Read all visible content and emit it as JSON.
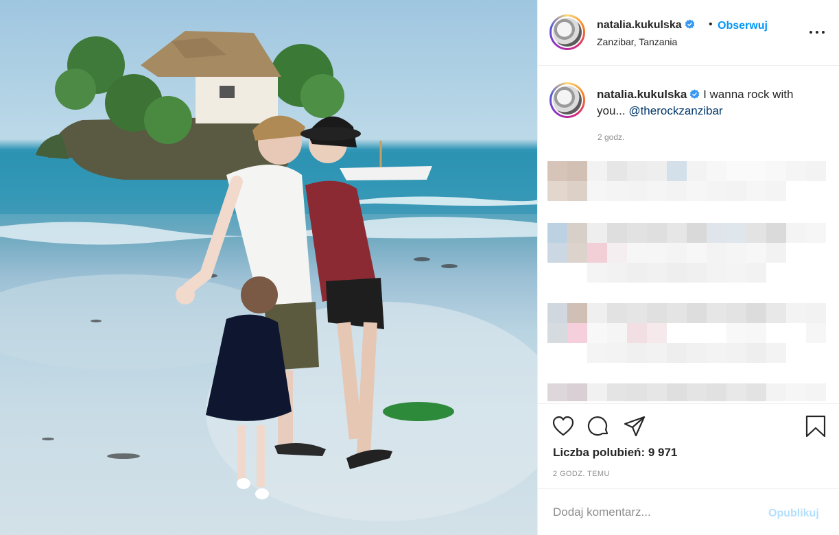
{
  "post": {
    "image_alt": "Family on a beach in front of a rock restaurant in Zanzibar",
    "colors": {
      "accent": "#0095f6",
      "mention": "#00376b",
      "muted": "#8e8e8e",
      "publish_disabled": "#b2dffc"
    }
  },
  "header": {
    "username": "natalia.kukulska",
    "separator": "•",
    "follow_label": "Obserwuj",
    "location": "Zanzibar, Tanzania",
    "icons": {
      "verified": "verified-badge-icon",
      "more": "more-options-icon"
    }
  },
  "caption": {
    "username": "natalia.kukulska",
    "text": "I wanna rock with you...",
    "mention": "@therockzanzibar",
    "time": "2 godz."
  },
  "actions": {
    "icons": [
      "heart-icon",
      "comment-icon",
      "share-icon",
      "bookmark-icon"
    ],
    "likes_label": "Liczba polubień: 9 971",
    "posted": "2 GODZ. TEMU"
  },
  "add_comment": {
    "placeholder": "Dodaj komentarz...",
    "publish_label": "Opublikuj"
  }
}
